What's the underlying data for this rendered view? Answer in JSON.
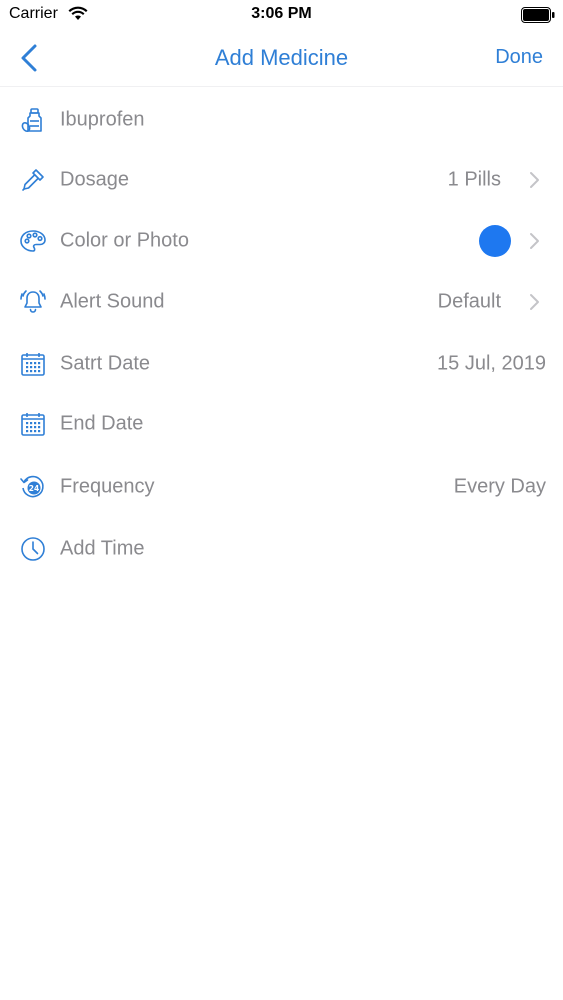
{
  "status_bar": {
    "carrier": "Carrier",
    "time": "3:06 PM"
  },
  "nav": {
    "title": "Add Medicine",
    "done_label": "Done"
  },
  "colors": {
    "accent": "#2f7fd6",
    "selected_color": "#1e78f0",
    "text": "#8a8a8e"
  },
  "rows": [
    {
      "icon": "medicine-bottle-icon",
      "label": "Ibuprofen",
      "value": ""
    },
    {
      "icon": "dropper-icon",
      "label": "Dosage",
      "value": "1 Pills"
    },
    {
      "icon": "palette-icon",
      "label": "Color or Photo",
      "value": ""
    },
    {
      "icon": "bell-icon",
      "label": "Alert Sound",
      "value": "Default"
    },
    {
      "icon": "calendar-icon",
      "label": "Satrt Date",
      "value": "15 Jul, 2019"
    },
    {
      "icon": "calendar-icon",
      "label": "End Date",
      "value": ""
    },
    {
      "icon": "clock-24-icon",
      "label": "Frequency",
      "value": "Every Day"
    },
    {
      "icon": "clock-icon",
      "label": "Add Time",
      "value": ""
    }
  ]
}
